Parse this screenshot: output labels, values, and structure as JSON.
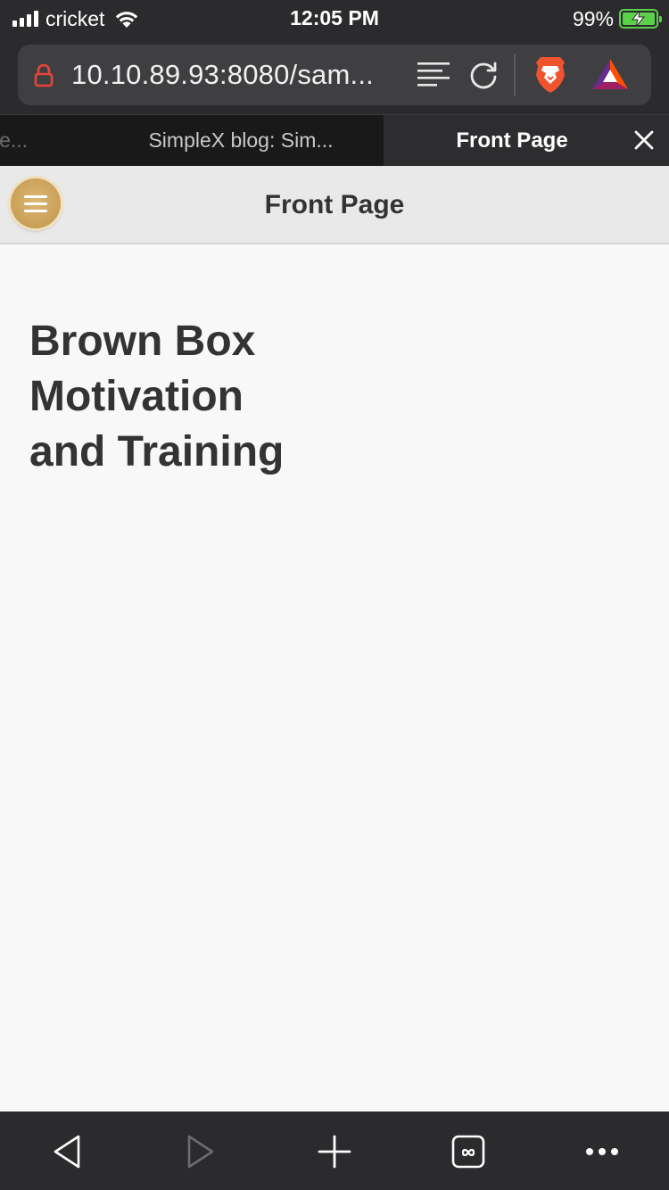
{
  "status_bar": {
    "carrier": "cricket",
    "time": "12:05 PM",
    "battery_percent": "99%",
    "battery_level": 0.99,
    "charging": true
  },
  "browser": {
    "url": "10.10.89.93:8080/sam...",
    "icons": [
      "lock-icon",
      "reader-mode-icon",
      "reload-icon",
      "brave-shields-icon",
      "brave-rewards-icon"
    ],
    "tabs": [
      {
        "label": "le...",
        "active": false
      },
      {
        "label": "SimpleX blog: Sim...",
        "active": false
      },
      {
        "label": "Front Page",
        "active": true
      }
    ],
    "toolbar": [
      "back-icon",
      "forward-icon",
      "new-tab-icon",
      "tabs-icon",
      "more-icon"
    ]
  },
  "page": {
    "header_title": "Front Page",
    "heading": "Brown Box Motivation and Training"
  },
  "colors": {
    "chrome": "#2b2b2d",
    "page_bg": "#f8f8f8",
    "header_bg": "#e9e9e9",
    "menu_button": "#c99f56",
    "text": "#333333",
    "battery": "#5ccf4b",
    "lock": "#e8443a"
  }
}
